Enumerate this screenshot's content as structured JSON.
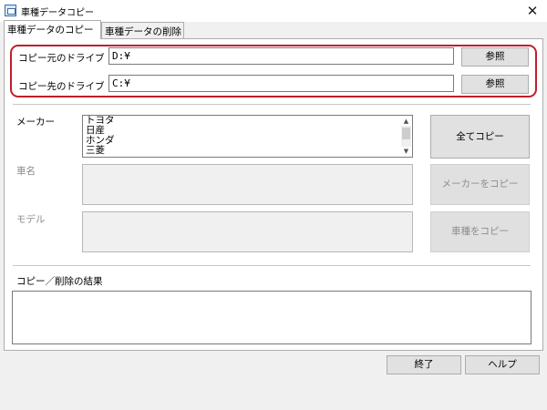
{
  "window": {
    "title": "車種データコピー",
    "close_glyph": "✕"
  },
  "tabs": [
    {
      "label": "車種データのコピー",
      "active": true
    },
    {
      "label": "車種データの削除",
      "active": false
    }
  ],
  "source_drive": {
    "label": "コピー元のドライブ",
    "value": "D:¥",
    "browse_label": "参照"
  },
  "dest_drive": {
    "label": "コピー先のドライブ",
    "value": "C:¥",
    "browse_label": "参照"
  },
  "maker": {
    "label": "メーカー",
    "items": [
      "トヨタ",
      "日産",
      "ホンダ",
      "三菱"
    ]
  },
  "car_name": {
    "label": "車名"
  },
  "model": {
    "label": "モデル"
  },
  "buttons": {
    "copy_all": "全てコピー",
    "copy_maker": "メーカーをコピー",
    "copy_car": "車種をコピー",
    "exit": "終了",
    "help": "ヘルプ"
  },
  "result": {
    "label": "コピー／削除の結果",
    "value": ""
  },
  "colors": {
    "highlight": "#c0202a"
  },
  "icons": {
    "app": "app-icon",
    "close": "close-icon",
    "scroll_up": "scroll-up-icon",
    "scroll_down": "scroll-down-icon"
  }
}
